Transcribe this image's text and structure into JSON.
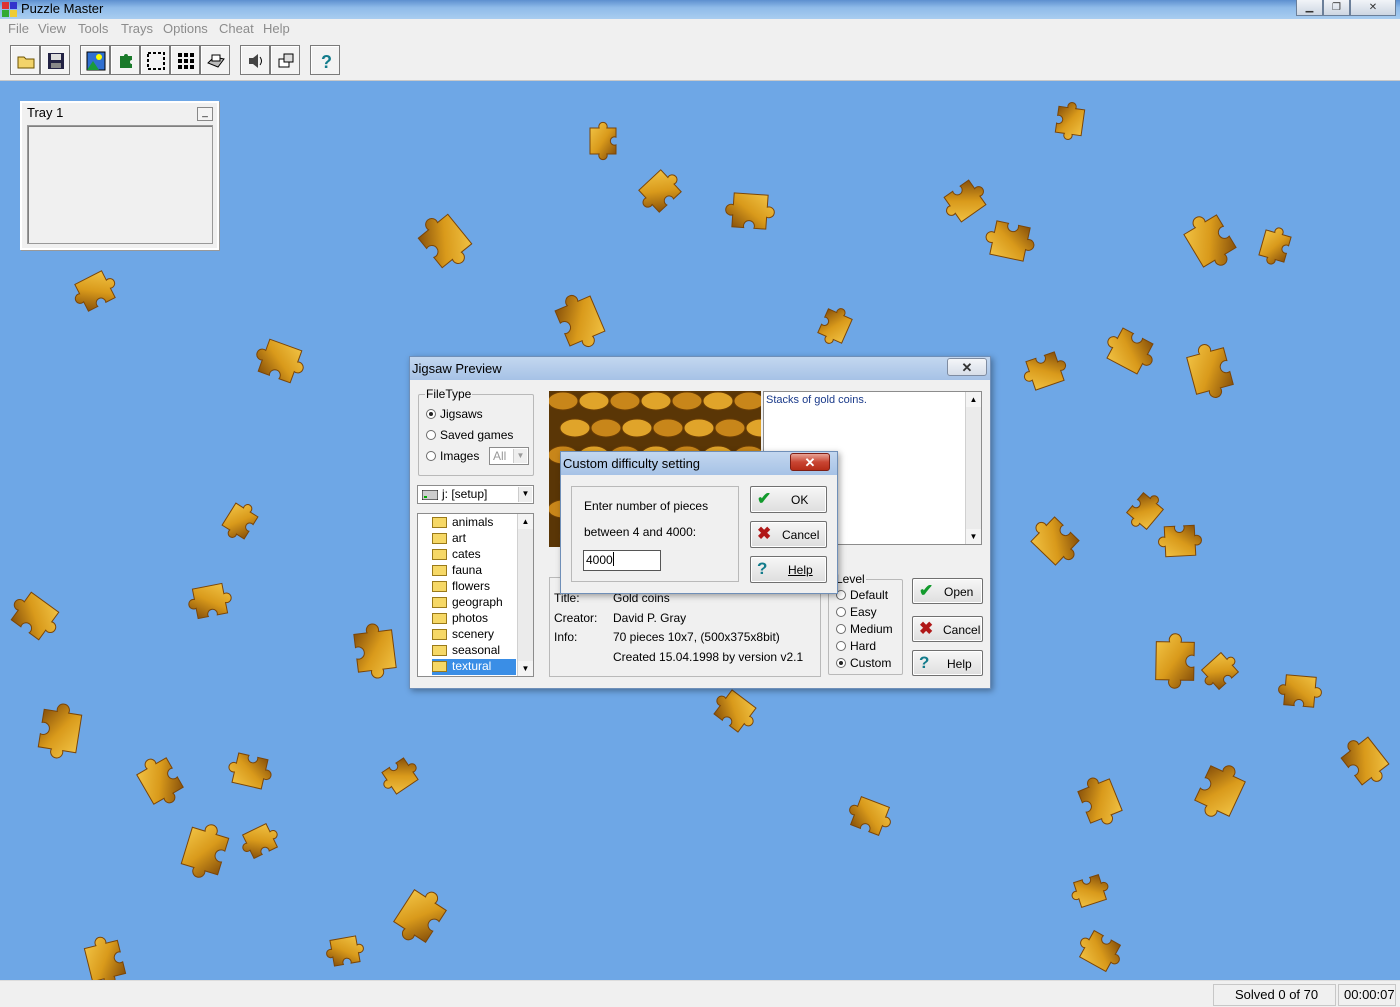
{
  "app": {
    "title": "Puzzle Master"
  },
  "window_controls": {
    "minimize": "▁",
    "restore": "❐",
    "close": "✕"
  },
  "menu": [
    "File",
    "View",
    "Tools",
    "Trays",
    "Options",
    "Cheat",
    "Help"
  ],
  "toolbar": {
    "buttons": [
      "open",
      "save",
      "preview-image",
      "pieces",
      "edge-pieces",
      "grid",
      "tray",
      "sound",
      "music",
      "help"
    ]
  },
  "tray": {
    "label": "Tray 1",
    "minimize": "_"
  },
  "jigsaw_preview": {
    "title": "Jigsaw Preview",
    "close": "✕",
    "filetype": {
      "label": "FileType",
      "options": [
        {
          "label": "Jigsaws",
          "checked": true
        },
        {
          "label": "Saved games",
          "checked": false
        },
        {
          "label": "Images",
          "checked": false
        }
      ],
      "images_filter": "All"
    },
    "drive": "j: [setup]",
    "folders": [
      "animals",
      "art",
      "cates",
      "fauna",
      "flowers",
      "geograph",
      "photos",
      "scenery",
      "seasonal",
      "textural"
    ],
    "selected_folder": "textural",
    "description": "Stacks of gold coins.",
    "info": {
      "title_label": "Title:",
      "title_value": "Gold coins",
      "creator_label": "Creator:",
      "creator_value": "David P. Gray",
      "info_label": "Info:",
      "info_value": "70 pieces 10x7, (500x375x8bit)",
      "created": "Created 15.04.1998 by version v2.1"
    },
    "level": {
      "label": "Level",
      "options": [
        {
          "label": "Default",
          "checked": false
        },
        {
          "label": "Easy",
          "checked": false
        },
        {
          "label": "Medium",
          "checked": false
        },
        {
          "label": "Hard",
          "checked": false
        },
        {
          "label": "Custom",
          "checked": true
        }
      ]
    },
    "buttons": {
      "open": "Open",
      "cancel": "Cancel",
      "help": "Help"
    }
  },
  "custom_dialog": {
    "title": "Custom difficulty setting",
    "close": "✕",
    "prompt_line1": "Enter number of pieces",
    "prompt_line2": "between 4 and 4000:",
    "value": "4000",
    "buttons": {
      "ok": "OK",
      "cancel": "Cancel",
      "help": "Help"
    }
  },
  "status": {
    "solved": "Solved 0 of 70",
    "time": "00:00:07"
  },
  "colors": {
    "background": "#6ea7e6",
    "gold": "#d99a1b",
    "dark_gold": "#7a4508"
  }
}
